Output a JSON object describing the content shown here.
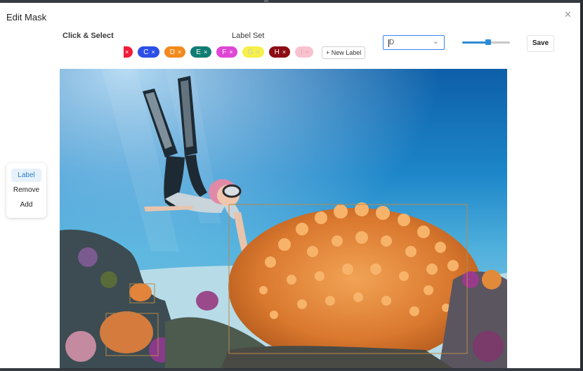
{
  "modal": {
    "title": "Edit Mask",
    "close_icon": "close-icon",
    "close_glyph": "✕"
  },
  "headers": {
    "click_select": "Click & Select",
    "label_set": "Label Set"
  },
  "labels": [
    {
      "letter": "",
      "color": "#ef1d3a",
      "text": "#ffffff"
    },
    {
      "letter": "C",
      "color": "#2d4fe6",
      "text": "#ffffff"
    },
    {
      "letter": "D",
      "color": "#f28a1d",
      "text": "#ffffff"
    },
    {
      "letter": "E",
      "color": "#0f7d73",
      "text": "#ffffff"
    },
    {
      "letter": "F",
      "color": "#e046d6",
      "text": "#ffffff"
    },
    {
      "letter": "G",
      "color": "#f6f04a",
      "text": "#c8c8c8"
    },
    {
      "letter": "H",
      "color": "#8c0d14",
      "text": "#ffffff"
    },
    {
      "letter": "I",
      "color": "#f8c1ce",
      "text": "#e8a0b0"
    }
  ],
  "chip_remove_glyph": "×",
  "new_label": "+ New Label",
  "select": {
    "value": "D",
    "chevron": "⌄"
  },
  "slider": {
    "value_fraction": 0.55
  },
  "save_label": "Save",
  "side_menu": [
    {
      "label": "Label",
      "active": true
    },
    {
      "label": "Remove",
      "active": false
    },
    {
      "label": "Add",
      "active": false
    }
  ],
  "colors": {
    "accent": "#2b8cd8",
    "box": "#b9894a"
  }
}
